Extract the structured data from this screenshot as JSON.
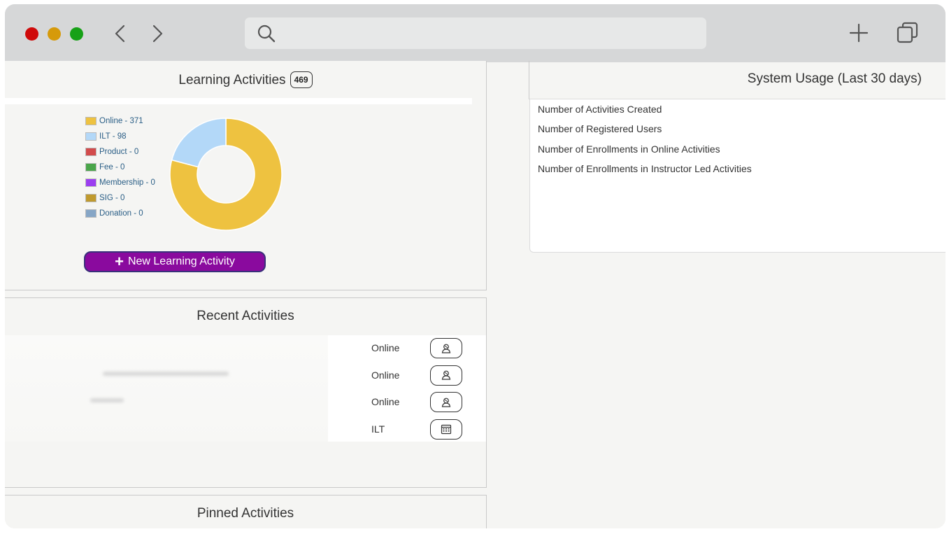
{
  "learning_activities": {
    "title": "Learning Activities",
    "count": "469",
    "legend": [
      {
        "label": "Online - 371",
        "color": "#eec240"
      },
      {
        "label": "ILT - 98",
        "color": "#b3d8f8"
      },
      {
        "label": "Product - 0",
        "color": "#d24b4b"
      },
      {
        "label": "Fee - 0",
        "color": "#4aa64a"
      },
      {
        "label": "Membership - 0",
        "color": "#9b3ef0"
      },
      {
        "label": "SIG - 0",
        "color": "#c09a2e"
      },
      {
        "label": "Donation - 0",
        "color": "#86a6c6"
      }
    ],
    "donut": [
      {
        "name": "Online",
        "value": 371,
        "color": "#eec240"
      },
      {
        "name": "ILT",
        "value": 98,
        "color": "#b3d8f8"
      }
    ],
    "new_button_label": "New Learning Activity"
  },
  "recent_activities": {
    "title": "Recent Activities",
    "rows": [
      {
        "type": "Online",
        "icon": "user-icon"
      },
      {
        "type": "Online",
        "icon": "user-icon"
      },
      {
        "type": "Online",
        "icon": "user-icon"
      },
      {
        "type": "ILT",
        "icon": "calendar-icon"
      }
    ]
  },
  "pinned_activities": {
    "title": "Pinned Activities"
  },
  "system_usage": {
    "title": "System Usage (Last 30 days)",
    "items": [
      "Number of Activities Created",
      "Number of Registered Users",
      "Number of Enrollments in Online Activities",
      "Number of Enrollments in Instructor Led Activities"
    ]
  },
  "colors": {
    "accent_button": "#8a0a9e",
    "button_border": "#3a2f7a"
  }
}
